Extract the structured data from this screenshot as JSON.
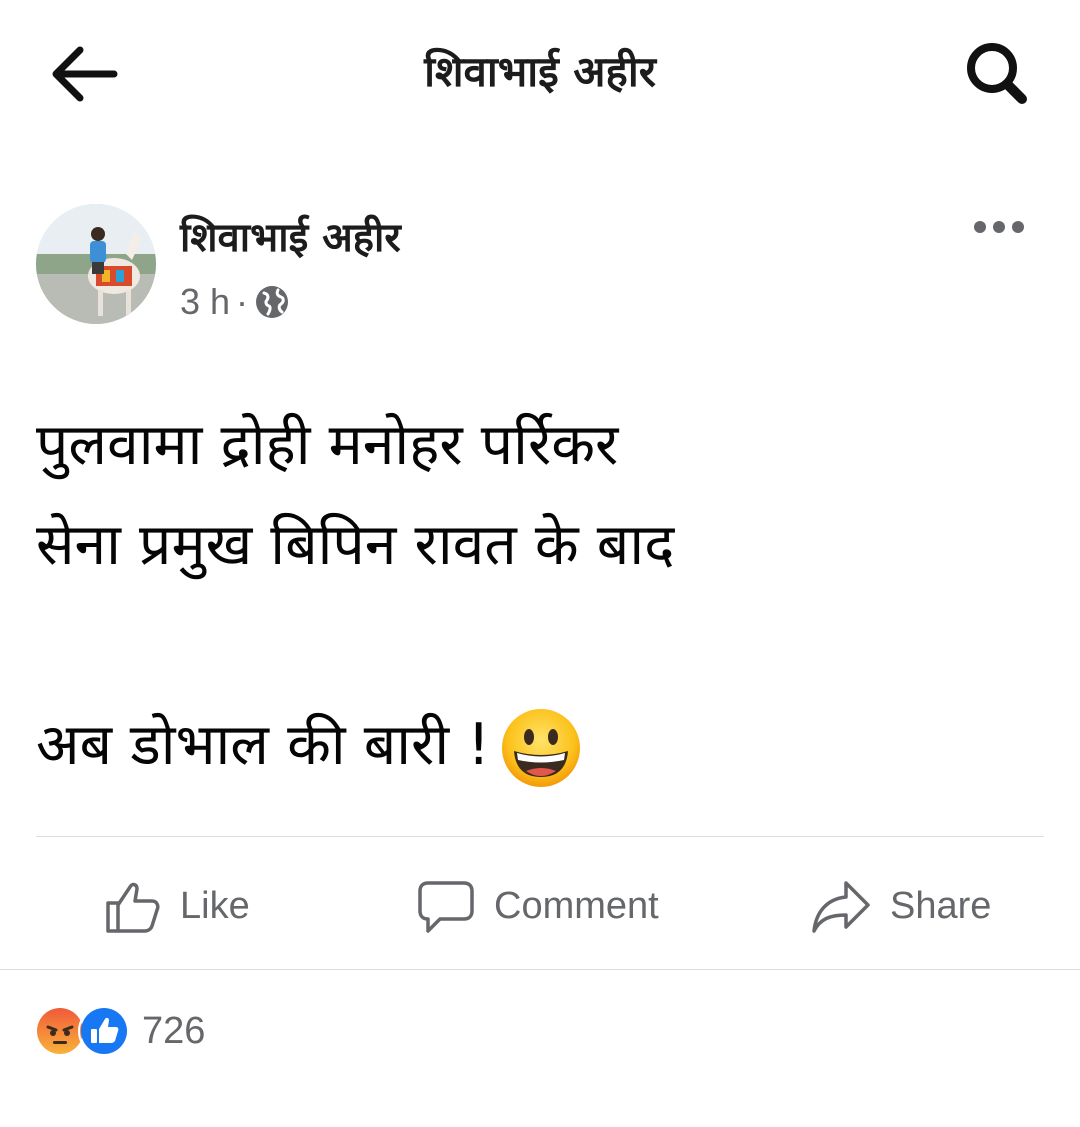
{
  "header": {
    "title": "शिवाभाई अहीर",
    "back_icon": "arrow-left-icon",
    "search_icon": "search-icon"
  },
  "post": {
    "author": "शिवाभाई अहीर",
    "time": "3 h",
    "separator": "·",
    "privacy_icon": "globe-icon",
    "more_icon": "more-horizontal-icon",
    "lines": [
      "पुलवामा द्रोही मनोहर पर्रिकर",
      "सेना प्रमुख बिपिन रावत के बाद",
      "",
      "अब डोभाल की बारी !"
    ],
    "emoji": "grinning-face-emoji"
  },
  "actions": {
    "like_label": "Like",
    "comment_label": "Comment",
    "share_label": "Share"
  },
  "reactions": {
    "icons": [
      "angry-reaction-icon",
      "like-reaction-icon"
    ],
    "count": "726"
  },
  "colors": {
    "text": "#050505",
    "secondary": "#65676b",
    "like_blue": "#1877f2",
    "divider": "#dadde1"
  }
}
